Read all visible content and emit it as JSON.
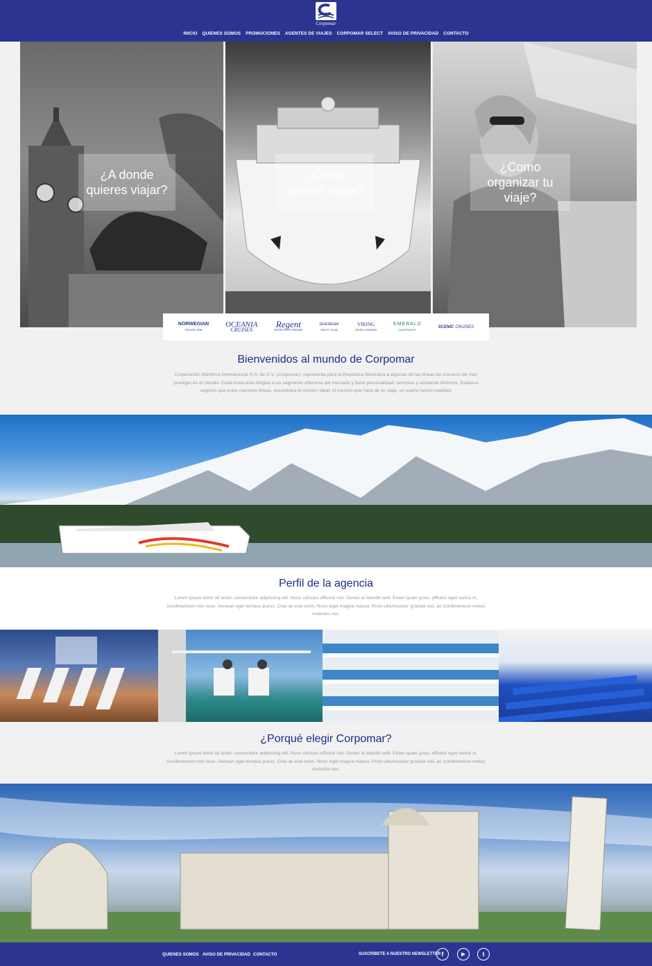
{
  "header": {
    "logo_text": "Corpomar",
    "nav": [
      "INICIO",
      "QUIENES SOMOS",
      "PROMOCIONES",
      "AGENTES DE VIAJES",
      "CORPOMAR SELECT",
      "AVISO DE PRIVACIDAD",
      "CONTACTO"
    ]
  },
  "hero": [
    {
      "title_line1": "¿A donde",
      "title_line2": "quieres viajar?"
    },
    {
      "title_line1": "¿Como",
      "title_line2": "quieres viajar?"
    },
    {
      "title_line1": "¿Como",
      "title_line2": "organizar tu viaje?"
    }
  ],
  "brands": [
    {
      "name": "NORWEGIAN",
      "sub": "CRUISE LINE"
    },
    {
      "name": "OCEANIA",
      "sub": "CRUISES"
    },
    {
      "name": "Regent",
      "sub": "SEVEN SEAS CRUISES"
    },
    {
      "name": "SEADREAM",
      "sub": "YACHT CLUB"
    },
    {
      "name": "VIKING",
      "sub": "RIVER CRUISES"
    },
    {
      "name": "EMERALD",
      "sub": "WATERWAYS"
    },
    {
      "name": "SCENIC",
      "sub": "CRUISES"
    }
  ],
  "welcome": {
    "title": "Bienvenidos al mundo de Corpomar",
    "text": "Corporación Marítima Internacional S.A. de C.V. (Corpomar), representa para la República Mexicana a algunas de las líneas de cruceros de más prestigio en el mundo. Cada línea esta dirigida a un segmento diferente del mercado y tiene personalidad, servicios y ambiente distintos. Estamos seguros que entre nuestras líneas, encontrara el crucero ideal, el crucero que hará de su viaje, un sueño hecho realidad."
  },
  "perfil": {
    "title": "Perfil de la agencia",
    "text": "Lorem ipsum dolor sit amet, consectetur adipiscing elit. Nunc ultricies efficitur nisl. Donec at blandit velit. Etiam quam justo, efficitur eget varius in, condimentum non risus. Aenean eget tempus purus. Cras ac erat enim. Nunc eget magna massa. Proin ullamcorper gravida nisl, ac condimentum metus molestie nec."
  },
  "porque": {
    "title": "¿Porqué elegir Corpomar?",
    "text": "Lorem ipsum dolor sit amet, consectetur adipiscing elit. Nunc ultricies efficitur nisl. Donec at blandit velit. Etiam quam justo, efficitur eget varius in, condimentum non risus. Aenean eget tempus purus. Cras ac erat enim. Nunc eget magna massa. Proin ullamcorper gravida nisl, ac condimentum metus molestie nec."
  },
  "footer": {
    "links": [
      "QUIENES SOMOS",
      "AVISO DE PRIVACIDAD",
      "CONTACTO"
    ],
    "newsletter": "SUSCRIBETE A NUESTRO NEWSLETTER",
    "social": [
      "f",
      "▶",
      "t"
    ]
  },
  "colors": {
    "brand_blue": "#2b3591",
    "heading_blue": "#1f2a84"
  }
}
